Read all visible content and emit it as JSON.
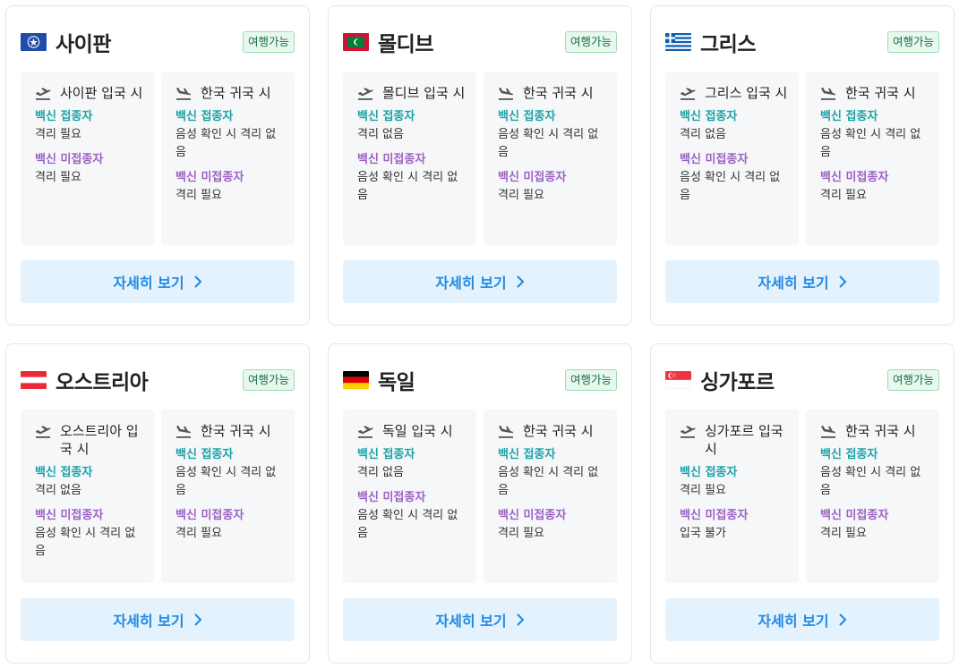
{
  "cards": [
    {
      "country": "사이판",
      "flag": "saipan",
      "badge": "여행가능",
      "entry": {
        "title": "사이판 입국 시",
        "vax_label": "백신 접종자",
        "vax_value": "격리 필요",
        "unvax_label": "백신 미접종자",
        "unvax_value": "격리 필요"
      },
      "return": {
        "title": "한국 귀국 시",
        "vax_label": "백신 접종자",
        "vax_value": "음성 확인 시 격리 없음",
        "unvax_label": "백신 미접종자",
        "unvax_value": "격리 필요"
      },
      "button": "자세히 보기"
    },
    {
      "country": "몰디브",
      "flag": "maldives",
      "badge": "여행가능",
      "entry": {
        "title": "몰디브 입국 시",
        "vax_label": "백신 접종자",
        "vax_value": "격리 없음",
        "unvax_label": "백신 미접종자",
        "unvax_value": "음성 확인 시 격리 없음"
      },
      "return": {
        "title": "한국 귀국 시",
        "vax_label": "백신 접종자",
        "vax_value": "음성 확인 시 격리 없음",
        "unvax_label": "백신 미접종자",
        "unvax_value": "격리 필요"
      },
      "button": "자세히 보기"
    },
    {
      "country": "그리스",
      "flag": "greece",
      "badge": "여행가능",
      "entry": {
        "title": "그리스 입국 시",
        "vax_label": "백신 접종자",
        "vax_value": "격리 없음",
        "unvax_label": "백신 미접종자",
        "unvax_value": "음성 확인 시 격리 없음"
      },
      "return": {
        "title": "한국 귀국 시",
        "vax_label": "백신 접종자",
        "vax_value": "음성 확인 시 격리 없음",
        "unvax_label": "백신 미접종자",
        "unvax_value": "격리 필요"
      },
      "button": "자세히 보기"
    },
    {
      "country": "오스트리아",
      "flag": "austria",
      "badge": "여행가능",
      "entry": {
        "title": "오스트리아 입국 시",
        "vax_label": "백신 접종자",
        "vax_value": "격리 없음",
        "unvax_label": "백신 미접종자",
        "unvax_value": "음성 확인 시 격리 없음"
      },
      "return": {
        "title": "한국 귀국 시",
        "vax_label": "백신 접종자",
        "vax_value": "음성 확인 시 격리 없음",
        "unvax_label": "백신 미접종자",
        "unvax_value": "격리 필요"
      },
      "button": "자세히 보기"
    },
    {
      "country": "독일",
      "flag": "germany",
      "badge": "여행가능",
      "entry": {
        "title": "독일 입국 시",
        "vax_label": "백신 접종자",
        "vax_value": "격리 없음",
        "unvax_label": "백신 미접종자",
        "unvax_value": "음성 확인 시 격리 없음"
      },
      "return": {
        "title": "한국 귀국 시",
        "vax_label": "백신 접종자",
        "vax_value": "음성 확인 시 격리 없음",
        "unvax_label": "백신 미접종자",
        "unvax_value": "격리 필요"
      },
      "button": "자세히 보기"
    },
    {
      "country": "싱가포르",
      "flag": "singapore",
      "badge": "여행가능",
      "entry": {
        "title": "싱가포르 입국 시",
        "vax_label": "백신 접종자",
        "vax_value": "격리 필요",
        "unvax_label": "백신 미접종자",
        "unvax_value": "입국 불가"
      },
      "return": {
        "title": "한국 귀국 시",
        "vax_label": "백신 접종자",
        "vax_value": "음성 확인 시 격리 없음",
        "unvax_label": "백신 미접종자",
        "unvax_value": "격리 필요"
      },
      "button": "자세히 보기"
    }
  ]
}
